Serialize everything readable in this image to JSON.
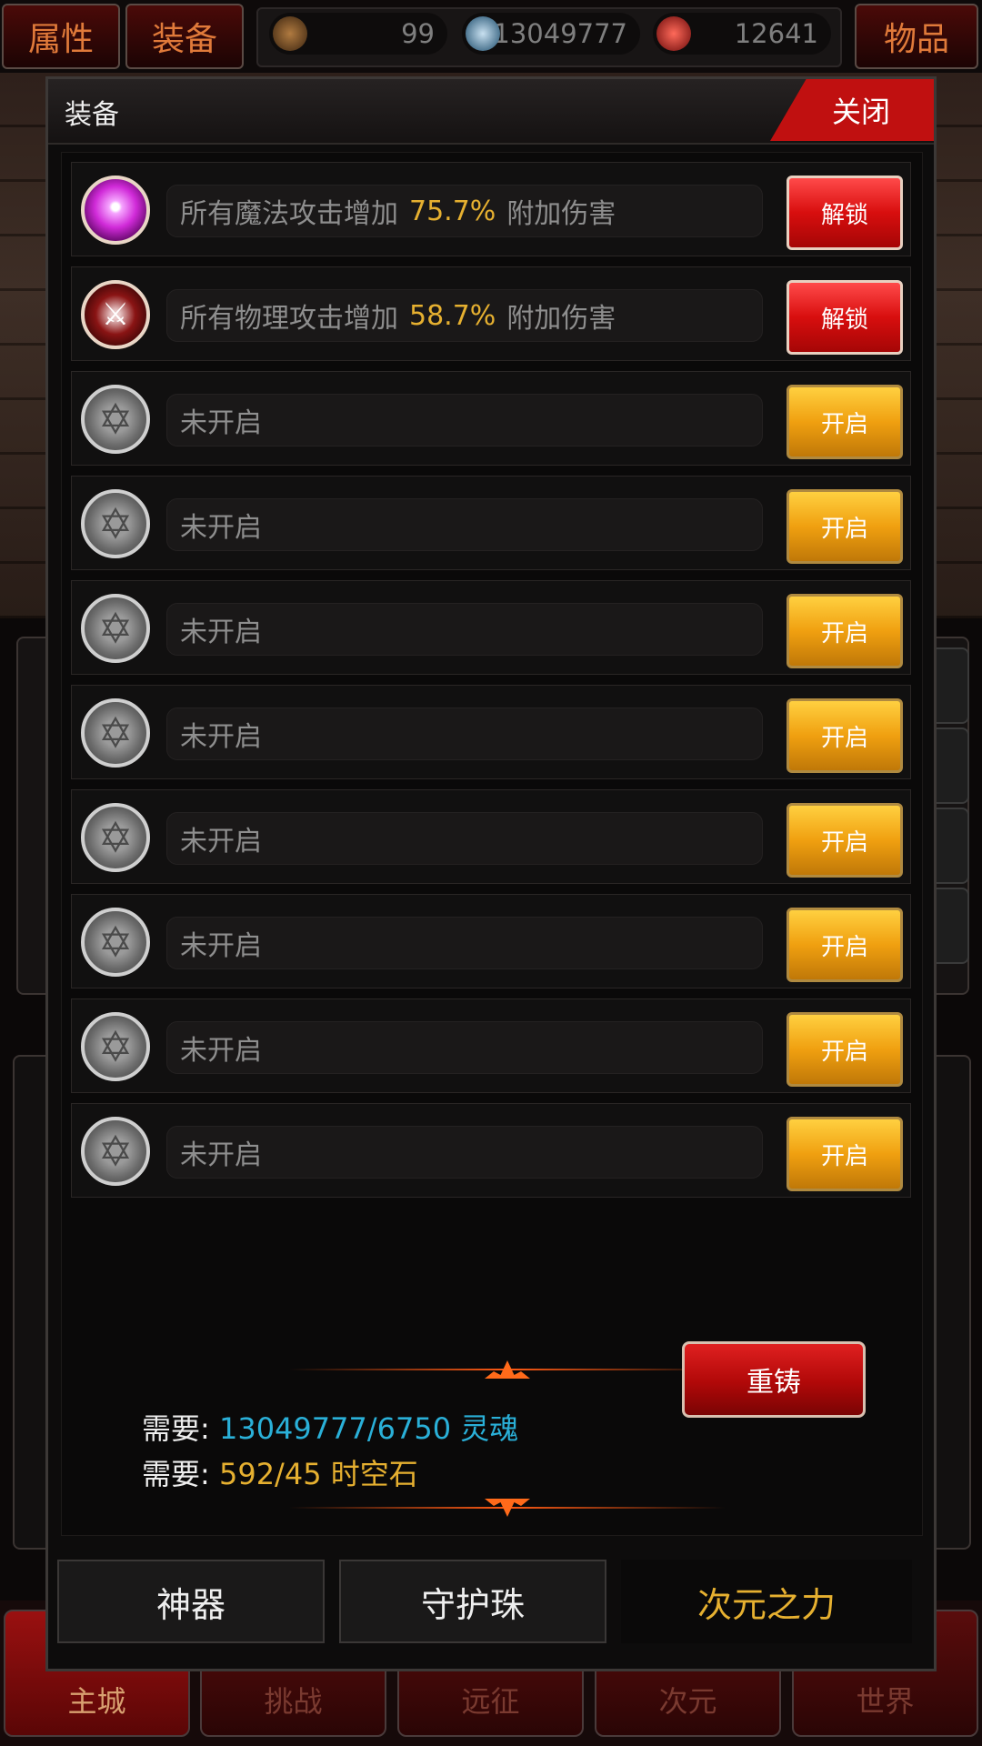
{
  "topbar": {
    "left_buttons": [
      "属性",
      "装备"
    ],
    "right_button": "物品",
    "resources": [
      {
        "icon": "star-emblem-icon",
        "value": "99"
      },
      {
        "icon": "skull-soul-icon",
        "value": "13049777"
      },
      {
        "icon": "red-vortex-icon",
        "value": "12641"
      }
    ]
  },
  "modal": {
    "title": "装备",
    "close_label": "关闭",
    "slots": [
      {
        "orb": "magic",
        "prefix": "所有魔法攻击增加",
        "value": "75.7%",
        "suffix": "附加伤害",
        "button": "解锁",
        "button_type": "unlock"
      },
      {
        "orb": "physical",
        "prefix": "所有物理攻击增加",
        "value": "58.7%",
        "suffix": "附加伤害",
        "button": "解锁",
        "button_type": "unlock"
      },
      {
        "orb": "locked",
        "prefix": "未开启",
        "value": "",
        "suffix": "",
        "button": "开启",
        "button_type": "open"
      },
      {
        "orb": "locked",
        "prefix": "未开启",
        "value": "",
        "suffix": "",
        "button": "开启",
        "button_type": "open"
      },
      {
        "orb": "locked",
        "prefix": "未开启",
        "value": "",
        "suffix": "",
        "button": "开启",
        "button_type": "open"
      },
      {
        "orb": "locked",
        "prefix": "未开启",
        "value": "",
        "suffix": "",
        "button": "开启",
        "button_type": "open"
      },
      {
        "orb": "locked",
        "prefix": "未开启",
        "value": "",
        "suffix": "",
        "button": "开启",
        "button_type": "open"
      },
      {
        "orb": "locked",
        "prefix": "未开启",
        "value": "",
        "suffix": "",
        "button": "开启",
        "button_type": "open"
      },
      {
        "orb": "locked",
        "prefix": "未开启",
        "value": "",
        "suffix": "",
        "button": "开启",
        "button_type": "open"
      },
      {
        "orb": "locked",
        "prefix": "未开启",
        "value": "",
        "suffix": "",
        "button": "开启",
        "button_type": "open"
      }
    ],
    "requirements": {
      "label": "需要:",
      "soul": "13049777/6750 灵魂",
      "stone": "592/45 时空石"
    },
    "recast_label": "重铸",
    "tabs": [
      "神器",
      "守护珠",
      "次元之力"
    ],
    "selected_tab": "次元之力"
  },
  "bottom_nav": [
    "主城",
    "挑战",
    "远征",
    "次元",
    "世界"
  ],
  "colors": {
    "accent_gold": "#e6b030",
    "accent_cyan": "#2ab0d8",
    "unlock_red": "#d80e0e",
    "open_yellow": "#f0a010",
    "close_red": "#c01010"
  }
}
